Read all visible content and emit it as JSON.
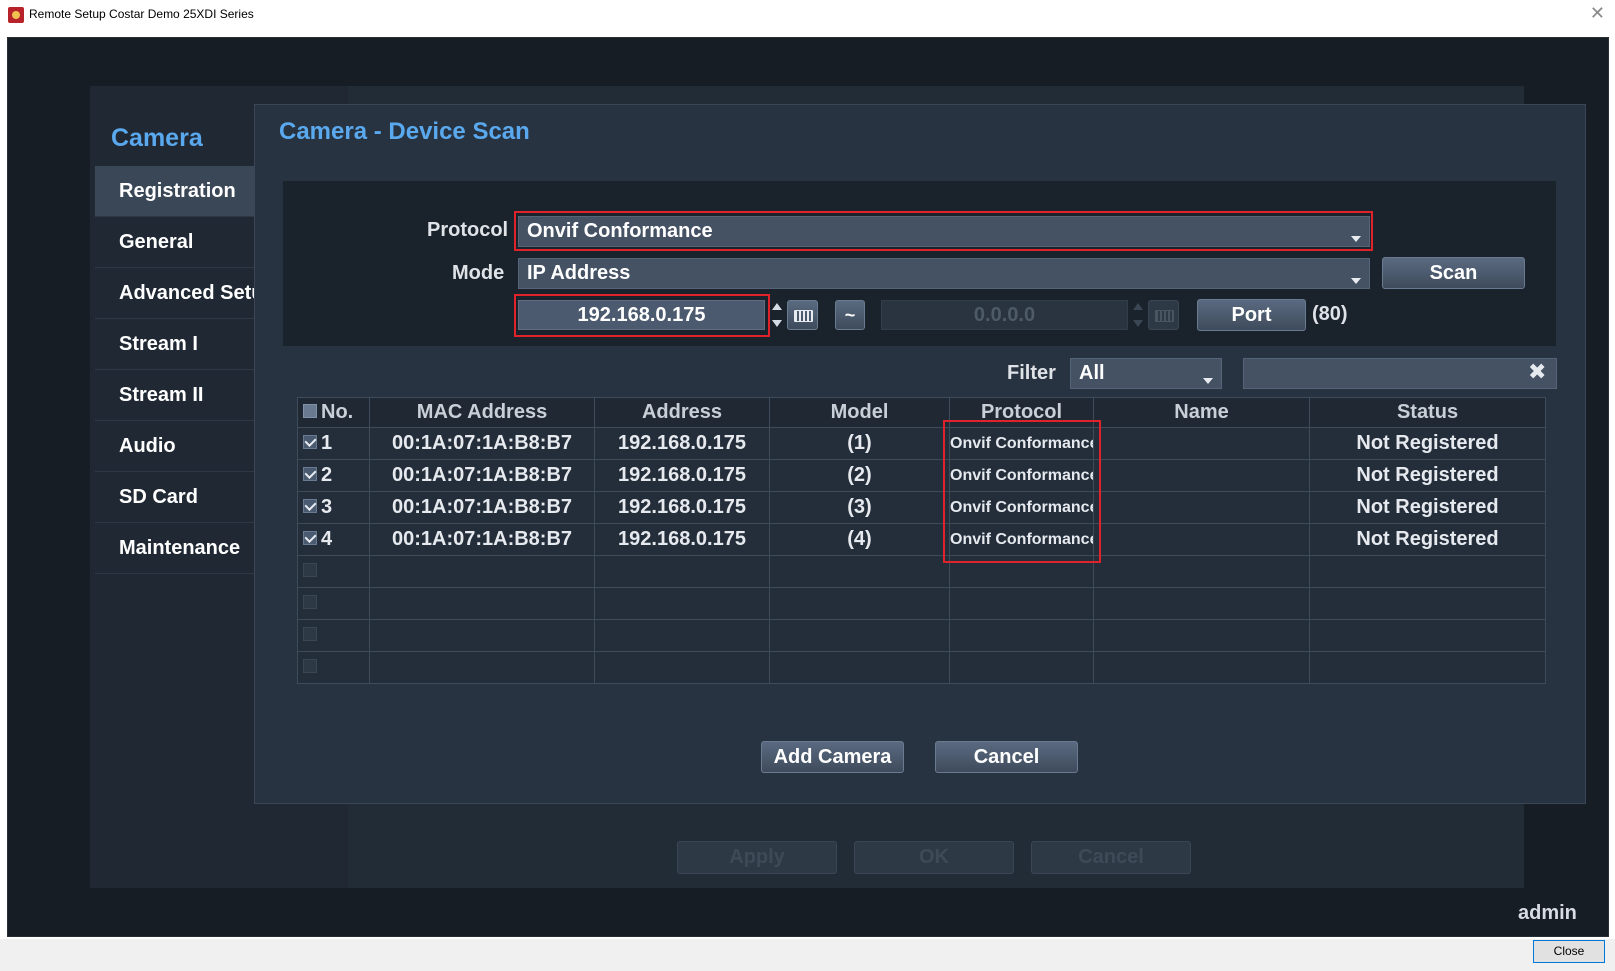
{
  "window": {
    "title": "Remote Setup Costar Demo 25XDI Series",
    "close_glyph": "✕",
    "close_button": "Close"
  },
  "sidebar": {
    "title": "Camera",
    "items": [
      {
        "label": "Registration",
        "active": true
      },
      {
        "label": "General"
      },
      {
        "label": "Advanced Setup"
      },
      {
        "label": "Stream I"
      },
      {
        "label": "Stream II"
      },
      {
        "label": "Audio"
      },
      {
        "label": "SD Card"
      },
      {
        "label": "Maintenance"
      }
    ]
  },
  "background_buttons": {
    "apply": "Apply",
    "ok": "OK",
    "cancel": "Cancel"
  },
  "user": "admin",
  "dialog": {
    "title": "Camera - Device Scan",
    "protocol_label": "Protocol",
    "protocol_value": "Onvif Conformance",
    "mode_label": "Mode",
    "mode_value": "IP Address",
    "scan_button": "Scan",
    "ip_start": "192.168.0.175",
    "range_button": "~",
    "ip_end": "0.0.0.0",
    "port_button": "Port",
    "port_value": "(80)",
    "filter_label": "Filter",
    "filter_value": "All",
    "filter_clear": "✖",
    "add_camera_button": "Add Camera",
    "cancel_button": "Cancel",
    "highlight_color": "#e0232a",
    "accent_color": "#5aa8ee"
  },
  "table": {
    "columns": [
      "No.",
      "MAC Address",
      "Address",
      "Model",
      "Protocol",
      "Name",
      "Status"
    ],
    "rows": [
      {
        "no": "1",
        "mac": "00:1A:07:1A:B8:B7",
        "address": "192.168.0.175",
        "model": "(1)",
        "protocol": "Onvif Conformance",
        "name": "",
        "status": "Not Registered"
      },
      {
        "no": "2",
        "mac": "00:1A:07:1A:B8:B7",
        "address": "192.168.0.175",
        "model": "(2)",
        "protocol": "Onvif Conformance",
        "name": "",
        "status": "Not Registered"
      },
      {
        "no": "3",
        "mac": "00:1A:07:1A:B8:B7",
        "address": "192.168.0.175",
        "model": "(3)",
        "protocol": "Onvif Conformance",
        "name": "",
        "status": "Not Registered"
      },
      {
        "no": "4",
        "mac": "00:1A:07:1A:B8:B7",
        "address": "192.168.0.175",
        "model": "(4)",
        "protocol": "Onvif Conformance",
        "name": "",
        "status": "Not Registered"
      }
    ]
  }
}
